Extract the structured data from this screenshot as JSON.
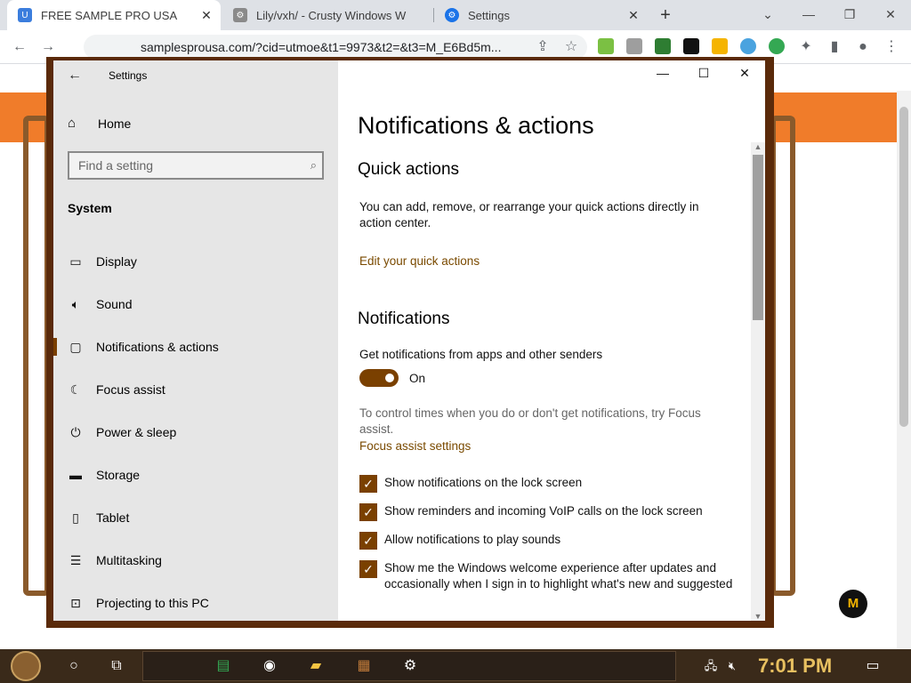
{
  "browser": {
    "tabs": [
      {
        "label": "FREE SAMPLE PRO USA",
        "active": true
      },
      {
        "label": "Lily/vxh/ - Crusty Windows W",
        "active": false
      },
      {
        "label": "Settings",
        "active": false
      }
    ],
    "new_tab": "+",
    "url": "samplesprousa.com/?cid=utmoe&t1=9973&t2=&t3=M_E6Bd5m..."
  },
  "settings": {
    "window_title": "Settings",
    "home_label": "Home",
    "search_placeholder": "Find a setting",
    "section_label": "System",
    "nav_items": [
      {
        "label": "Display",
        "icon": "display-icon"
      },
      {
        "label": "Sound",
        "icon": "speaker-icon"
      },
      {
        "label": "Notifications & actions",
        "icon": "notification-icon",
        "selected": true
      },
      {
        "label": "Focus assist",
        "icon": "moon-icon"
      },
      {
        "label": "Power & sleep",
        "icon": "power-icon"
      },
      {
        "label": "Storage",
        "icon": "storage-icon"
      },
      {
        "label": "Tablet",
        "icon": "tablet-icon"
      },
      {
        "label": "Multitasking",
        "icon": "multitasking-icon"
      },
      {
        "label": "Projecting to this PC",
        "icon": "projecting-icon"
      }
    ],
    "page_title": "Notifications & actions",
    "quick_actions": {
      "heading": "Quick actions",
      "description": "You can add, remove, or rearrange your quick actions directly in action center.",
      "link": "Edit your quick actions"
    },
    "notifications": {
      "heading": "Notifications",
      "toggle_caption": "Get notifications from apps and other senders",
      "toggle_state": "On",
      "focus_hint": "To control times when you do or don't get notifications, try Focus assist.",
      "focus_link": "Focus assist settings",
      "checkboxes": [
        {
          "label": "Show notifications on the lock screen",
          "checked": true
        },
        {
          "label": "Show reminders and incoming VoIP calls on the lock screen",
          "checked": true
        },
        {
          "label": "Allow notifications to play sounds",
          "checked": true
        },
        {
          "label": "Show me the Windows welcome experience after updates and occasionally when I sign in to highlight what's new and suggested",
          "checked": true
        }
      ]
    }
  },
  "taskbar": {
    "clock": "7:01 PM"
  },
  "colors": {
    "accent": "#7a4000",
    "page_band": "#f07c2a",
    "frame": "#5a2a0a"
  }
}
